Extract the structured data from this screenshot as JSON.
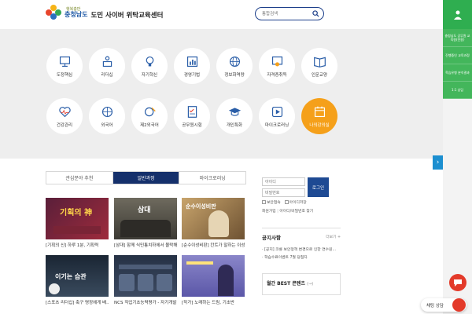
{
  "header": {
    "logo_small": "행복충만",
    "logo_big": "충청남도",
    "site_title": "도민 사이버 위탁교육센터",
    "search_placeholder": "통합검색"
  },
  "categories": [
    {
      "label": "도정핵심",
      "icon": "monitor-icon"
    },
    {
      "label": "리더십",
      "icon": "podium-icon"
    },
    {
      "label": "자기혁신",
      "icon": "lightbulb-icon"
    },
    {
      "label": "경영기법",
      "icon": "chart-icon"
    },
    {
      "label": "정보화역량",
      "icon": "globe-icon"
    },
    {
      "label": "자격증취득",
      "icon": "certificate-icon"
    },
    {
      "label": "인문교양",
      "icon": "book-icon"
    },
    {
      "label": "건강관리",
      "icon": "heart-icon"
    },
    {
      "label": "외국어",
      "icon": "globe-lang-icon"
    },
    {
      "label": "제2외국어",
      "icon": "globe-pen-icon"
    },
    {
      "label": "공무원시험",
      "icon": "checklist-icon"
    },
    {
      "label": "개인특화",
      "icon": "graduation-cap-icon"
    },
    {
      "label": "마이크로러닝",
      "icon": "play-icon"
    },
    {
      "label": "나의강의실",
      "icon": "calendar-icon"
    }
  ],
  "rail": {
    "items": [
      "충청남도 공무원 교육원(전용)",
      "진행중인 교육과정",
      "학습유형 분석결과",
      "1:1 상담"
    ]
  },
  "tabs": [
    "관심분야 추천",
    "일반과정",
    "마이크로러닝"
  ],
  "courses": [
    {
      "caption": "[기획의 신] 하루 1분, 기획력",
      "thumb_text": "기획의 神"
    },
    {
      "caption": "[삼대] 함께 식민통치하에서 몰락해...",
      "thumb_text": "삼대"
    },
    {
      "caption": "[순수이성비판] 칸트가 말하는 이성...",
      "thumb_text": "순수이성비판"
    },
    {
      "caption": "[스포츠 리더십] 축구 명장에게 배...",
      "thumb_text": "이기는 습관"
    },
    {
      "caption": "NCS 직업기초능력평가 - 자기개발...",
      "thumb_text": ""
    },
    {
      "caption": "[작가] 노래하는 드림, 기초반",
      "thumb_text": ""
    }
  ],
  "login": {
    "id_placeholder": "아이디",
    "pw_placeholder": "비밀번호",
    "button": "로그인",
    "save_id": "보안접속",
    "save_id2": "아이디저장",
    "join": "회원가입",
    "find": "아이디/비밀번호 찾기"
  },
  "notice": {
    "title": "공지사항",
    "more": "더보기 +",
    "items": [
      "[공지] 코룡 보안정책 변경으로 인한 연수원...",
      "학습수료이벤트 7월 당첨자"
    ]
  },
  "best": {
    "title": "월간 BEST 콘텐츠",
    "arrow": "(→)"
  },
  "chat": {
    "label": "채팅 상담"
  },
  "colors": {
    "navy": "#15306b",
    "green": "#2fae50",
    "orange": "#f5a01a",
    "red": "#e33a2a"
  }
}
